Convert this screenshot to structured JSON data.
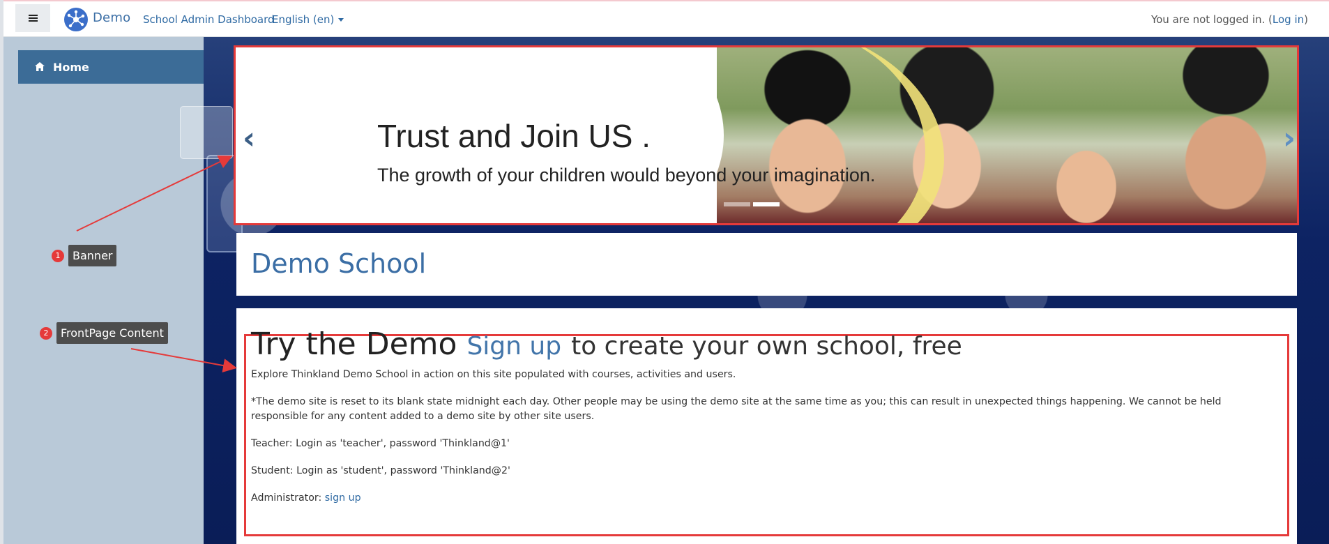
{
  "navbar": {
    "brand": "Demo",
    "links": [
      "School Admin Dashboard",
      "English (en)"
    ],
    "login_text": "You are not logged in. (",
    "login_link": "Log in",
    "login_close": ")"
  },
  "sidebar": {
    "home_label": "Home"
  },
  "banner": {
    "title": "Trust and Join US .",
    "subtitle": "The growth of your children would beyond your imagination."
  },
  "site": {
    "name": "Demo School"
  },
  "content": {
    "headline_main": "Try the Demo",
    "headline_link": "Sign up",
    "headline_rest": "to create your own school, free",
    "p1": "Explore Thinkland Demo School in action on this site populated with courses, activities and users.",
    "p2": "*The demo site is reset to its blank state midnight each day. Other people may be using the demo site at the same time as you; this can result in unexpected things happening. We cannot be held responsible for any content added to a demo site by other site users.",
    "p3": "Teacher: Login as 'teacher', password 'Thinkland@1'",
    "p4": "Student: Login as 'student', password 'Thinkland@2'",
    "p5_label": "Administrator:",
    "p5_link": "sign up"
  },
  "annotations": [
    {
      "num": "1",
      "label": "Banner"
    },
    {
      "num": "2",
      "label": "FrontPage Content"
    }
  ],
  "colors": {
    "accent_red": "#e53a3a",
    "link_blue": "#2f6aa3",
    "sidebar_home_bg": "#3c6c97"
  }
}
